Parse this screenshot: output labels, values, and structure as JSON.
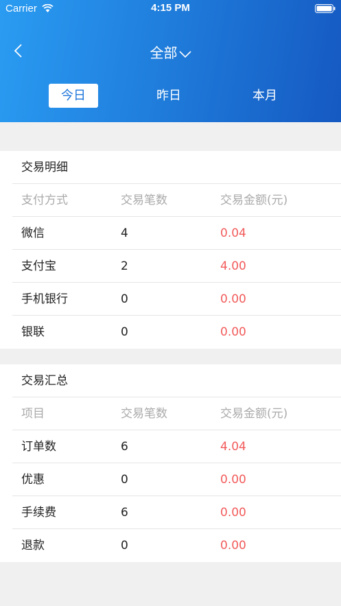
{
  "status_bar": {
    "carrier": "Carrier",
    "time": "4:15 PM"
  },
  "nav": {
    "title": "全部",
    "back_icon": "chevron-left-icon",
    "dropdown_icon": "chevron-down-icon"
  },
  "tabs": [
    {
      "label": "今日",
      "active": true
    },
    {
      "label": "昨日",
      "active": false
    },
    {
      "label": "本月",
      "active": false
    }
  ],
  "detail": {
    "title": "交易明细",
    "columns": [
      "支付方式",
      "交易笔数",
      "交易金额(元)"
    ],
    "rows": [
      [
        "微信",
        "4",
        "0.04"
      ],
      [
        "支付宝",
        "2",
        "4.00"
      ],
      [
        "手机银行",
        "0",
        "0.00"
      ],
      [
        "银联",
        "0",
        "0.00"
      ]
    ]
  },
  "summary": {
    "title": "交易汇总",
    "columns": [
      "项目",
      "交易笔数",
      "交易金额(元)"
    ],
    "rows": [
      [
        "订单数",
        "6",
        "4.04"
      ],
      [
        "优惠",
        "0",
        "0.00"
      ],
      [
        "手续费",
        "6",
        "0.00"
      ],
      [
        "退款",
        "0",
        "0.00"
      ]
    ]
  },
  "colors": {
    "header_start": "#2a9cf2",
    "header_end": "#1559c2",
    "amount": "#f25a5a",
    "muted": "#aaaaaa"
  }
}
